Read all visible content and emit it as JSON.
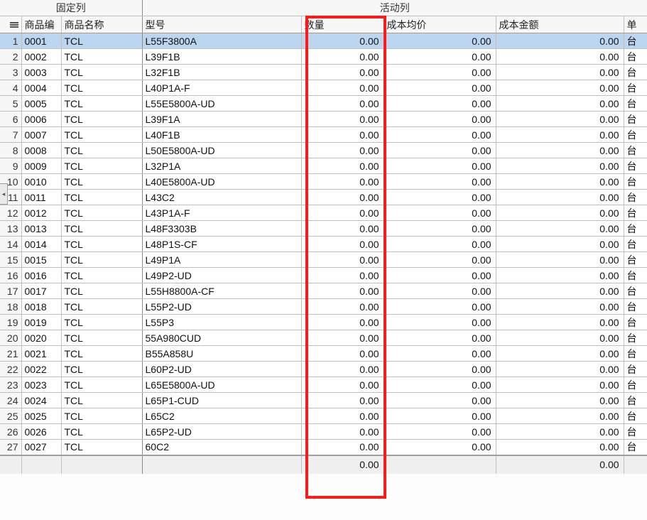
{
  "categories": {
    "fixed": "固定列",
    "active": "活动列"
  },
  "columns": {
    "row_no": "",
    "code": "商品编",
    "name": "商品名称",
    "model": "型号",
    "qty": "数量",
    "price": "成本均价",
    "amount": "成本金额",
    "unit": "单"
  },
  "rows": [
    {
      "no": "1",
      "code": "0001",
      "name": "TCL",
      "model": "L55F3800A",
      "qty": "0.00",
      "price": "0.00",
      "amount": "0.00",
      "unit": "台",
      "selected": true
    },
    {
      "no": "2",
      "code": "0002",
      "name": "TCL",
      "model": "L39F1B",
      "qty": "0.00",
      "price": "0.00",
      "amount": "0.00",
      "unit": "台"
    },
    {
      "no": "3",
      "code": "0003",
      "name": "TCL",
      "model": "L32F1B",
      "qty": "0.00",
      "price": "0.00",
      "amount": "0.00",
      "unit": "台"
    },
    {
      "no": "4",
      "code": "0004",
      "name": "TCL",
      "model": "L40P1A-F",
      "qty": "0.00",
      "price": "0.00",
      "amount": "0.00",
      "unit": "台"
    },
    {
      "no": "5",
      "code": "0005",
      "name": "TCL",
      "model": "L55E5800A-UD",
      "qty": "0.00",
      "price": "0.00",
      "amount": "0.00",
      "unit": "台"
    },
    {
      "no": "6",
      "code": "0006",
      "name": "TCL",
      "model": "L39F1A",
      "qty": "0.00",
      "price": "0.00",
      "amount": "0.00",
      "unit": "台"
    },
    {
      "no": "7",
      "code": "0007",
      "name": "TCL",
      "model": "L40F1B",
      "qty": "0.00",
      "price": "0.00",
      "amount": "0.00",
      "unit": "台"
    },
    {
      "no": "8",
      "code": "0008",
      "name": "TCL",
      "model": "L50E5800A-UD",
      "qty": "0.00",
      "price": "0.00",
      "amount": "0.00",
      "unit": "台"
    },
    {
      "no": "9",
      "code": "0009",
      "name": "TCL",
      "model": "L32P1A",
      "qty": "0.00",
      "price": "0.00",
      "amount": "0.00",
      "unit": "台"
    },
    {
      "no": "10",
      "code": "0010",
      "name": "TCL",
      "model": "L40E5800A-UD",
      "qty": "0.00",
      "price": "0.00",
      "amount": "0.00",
      "unit": "台"
    },
    {
      "no": "11",
      "code": "0011",
      "name": "TCL",
      "model": "L43C2",
      "qty": "0.00",
      "price": "0.00",
      "amount": "0.00",
      "unit": "台"
    },
    {
      "no": "12",
      "code": "0012",
      "name": "TCL",
      "model": "L43P1A-F",
      "qty": "0.00",
      "price": "0.00",
      "amount": "0.00",
      "unit": "台"
    },
    {
      "no": "13",
      "code": "0013",
      "name": "TCL",
      "model": "L48F3303B",
      "qty": "0.00",
      "price": "0.00",
      "amount": "0.00",
      "unit": "台"
    },
    {
      "no": "14",
      "code": "0014",
      "name": "TCL",
      "model": "L48P1S-CF",
      "qty": "0.00",
      "price": "0.00",
      "amount": "0.00",
      "unit": "台"
    },
    {
      "no": "15",
      "code": "0015",
      "name": "TCL",
      "model": "L49P1A",
      "qty": "0.00",
      "price": "0.00",
      "amount": "0.00",
      "unit": "台"
    },
    {
      "no": "16",
      "code": "0016",
      "name": "TCL",
      "model": "L49P2-UD",
      "qty": "0.00",
      "price": "0.00",
      "amount": "0.00",
      "unit": "台"
    },
    {
      "no": "17",
      "code": "0017",
      "name": "TCL",
      "model": "L55H8800A-CF",
      "qty": "0.00",
      "price": "0.00",
      "amount": "0.00",
      "unit": "台"
    },
    {
      "no": "18",
      "code": "0018",
      "name": "TCL",
      "model": "L55P2-UD",
      "qty": "0.00",
      "price": "0.00",
      "amount": "0.00",
      "unit": "台"
    },
    {
      "no": "19",
      "code": "0019",
      "name": "TCL",
      "model": "L55P3",
      "qty": "0.00",
      "price": "0.00",
      "amount": "0.00",
      "unit": "台"
    },
    {
      "no": "20",
      "code": "0020",
      "name": "TCL",
      "model": "55A980CUD",
      "qty": "0.00",
      "price": "0.00",
      "amount": "0.00",
      "unit": "台"
    },
    {
      "no": "21",
      "code": "0021",
      "name": "TCL",
      "model": "B55A858U",
      "qty": "0.00",
      "price": "0.00",
      "amount": "0.00",
      "unit": "台"
    },
    {
      "no": "22",
      "code": "0022",
      "name": "TCL",
      "model": "L60P2-UD",
      "qty": "0.00",
      "price": "0.00",
      "amount": "0.00",
      "unit": "台"
    },
    {
      "no": "23",
      "code": "0023",
      "name": "TCL",
      "model": "L65E5800A-UD",
      "qty": "0.00",
      "price": "0.00",
      "amount": "0.00",
      "unit": "台"
    },
    {
      "no": "24",
      "code": "0024",
      "name": "TCL",
      "model": "L65P1-CUD",
      "qty": "0.00",
      "price": "0.00",
      "amount": "0.00",
      "unit": "台"
    },
    {
      "no": "25",
      "code": "0025",
      "name": "TCL",
      "model": "L65C2",
      "qty": "0.00",
      "price": "0.00",
      "amount": "0.00",
      "unit": "台"
    },
    {
      "no": "26",
      "code": "0026",
      "name": "TCL",
      "model": "L65P2-UD",
      "qty": "0.00",
      "price": "0.00",
      "amount": "0.00",
      "unit": "台"
    },
    {
      "no": "27",
      "code": "0027",
      "name": "TCL",
      "model": "60C2",
      "qty": "0.00",
      "price": "0.00",
      "amount": "0.00",
      "unit": "台"
    }
  ],
  "summary": {
    "qty": "0.00",
    "price": "",
    "amount": "0.00"
  },
  "icons": {
    "row_handle": "menu-icon",
    "edge_tab": "◂"
  }
}
